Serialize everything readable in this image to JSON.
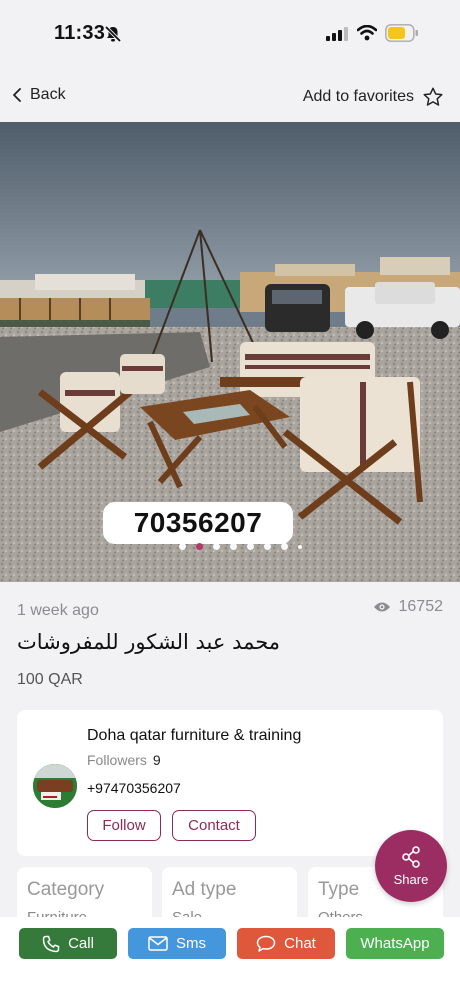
{
  "status_bar": {
    "time": "11:33"
  },
  "nav": {
    "back_label": "Back",
    "favorites_label": "Add to favorites"
  },
  "photo": {
    "phone_overlay": "70356207",
    "dot_count": 8,
    "active_dot": 1
  },
  "listing": {
    "posted": "1 week ago",
    "views": "16752",
    "title": "محمد عبد الشكور للمفروشات",
    "price": "100 QAR"
  },
  "seller": {
    "name": "Doha qatar furniture & training",
    "followers_label": "Followers",
    "followers_count": "9",
    "phone": "+97470356207",
    "follow_label": "Follow",
    "contact_label": "Contact"
  },
  "share": {
    "label": "Share"
  },
  "details": [
    {
      "key": "Category",
      "value": "Furniture"
    },
    {
      "key": "Ad type",
      "value": "Sale"
    },
    {
      "key": "Type",
      "value": "Others"
    }
  ],
  "actions": {
    "call": "Call",
    "sms": "Sms",
    "chat": "Chat",
    "whatsapp": "WhatsApp"
  },
  "colors": {
    "brand": "#9b2d62",
    "call": "#357a3b",
    "sms": "#4496dd",
    "chat": "#e0583c",
    "whatsapp": "#4caf50"
  }
}
